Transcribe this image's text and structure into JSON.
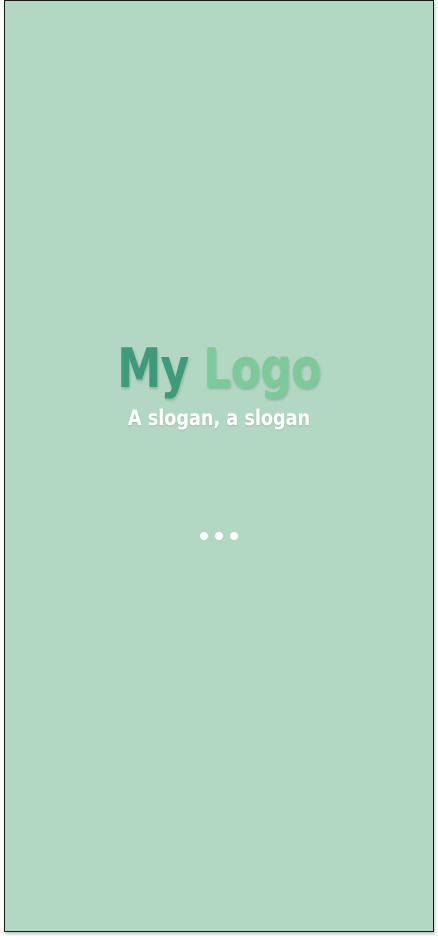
{
  "splash": {
    "logo": {
      "word1": "My",
      "word2": "Logo"
    },
    "slogan": "A slogan, a slogan",
    "loader": {
      "dot_count": 3
    }
  },
  "colors": {
    "background": "#b2d8c3",
    "logo_word1": "#3f9a7b",
    "logo_word2": "#7cc99a",
    "slogan": "#ffffff",
    "loader_dots": "#ffffff"
  }
}
